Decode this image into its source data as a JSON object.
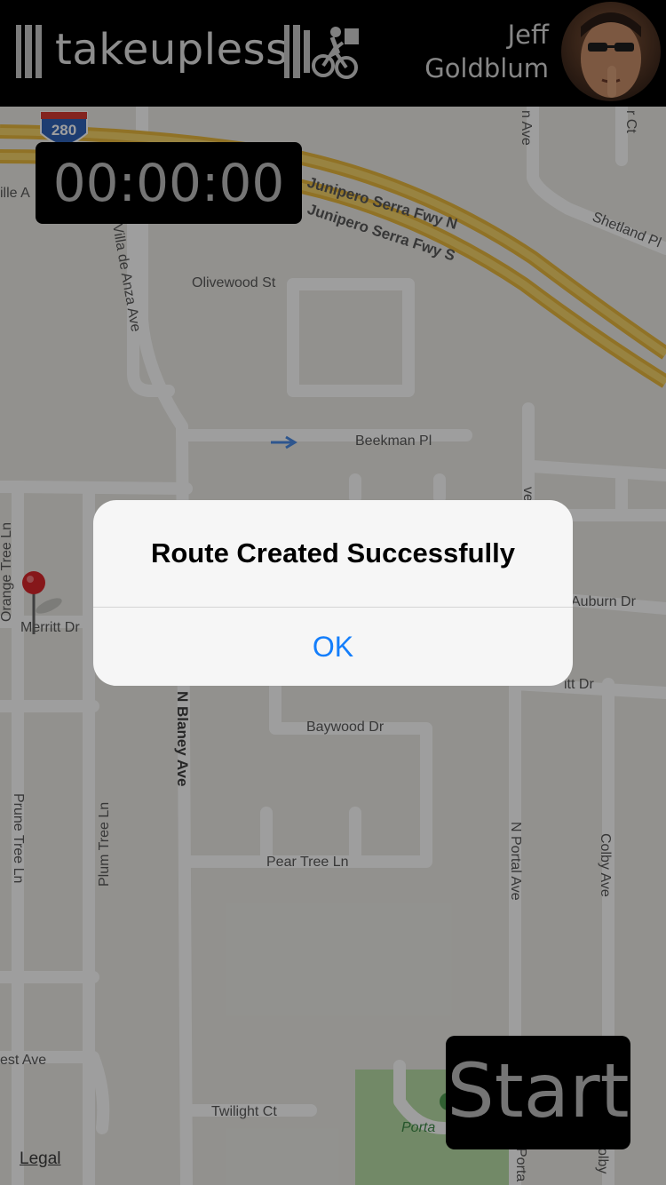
{
  "header": {
    "brand": "takeupless",
    "user_first": "Jeff",
    "user_last": "Goldblum"
  },
  "timer": {
    "value": "00:00:00"
  },
  "map": {
    "shield": "280",
    "streets": {
      "fwy_n": "Junipero Serra Fwy N",
      "fwy_s": "Junipero Serra Fwy S",
      "shetland": "Shetland Pl",
      "villa_de_anza": "Villa de Anza Ave",
      "olivewood": "Olivewood St",
      "beekman": "Beekman Pl",
      "orange_tree": "Orange Tree Ln",
      "merritt": "Merritt Dr",
      "auburn": "Auburn Dr",
      "merritt_right": "itt Dr",
      "baywood": "Baywood Dr",
      "blaney": "N Blaney Ave",
      "prune_tree": "Prune Tree Ln",
      "plum_tree": "Plum Tree Ln",
      "pear_tree": "Pear Tree Ln",
      "portal": "N Portal Ave",
      "colby": "Colby Ave",
      "twilight": "Twilight Ct",
      "forest": "est Ave",
      "ille": "ille A",
      "park": "Porta",
      "top_ave": "n Ave",
      "top_ct": "r Ct",
      "portal_bottom": "Porta",
      "colby_bottom": "olby",
      "ave_mid": "ve"
    }
  },
  "alert": {
    "title": "Route Created Successfully",
    "ok_label": "OK"
  },
  "start_label": "Start",
  "legal_label": "Legal",
  "colors": {
    "accent": "#147efb",
    "freeway": "#f2c84b",
    "park": "#b8e0a5",
    "pin": "#d9262b"
  }
}
